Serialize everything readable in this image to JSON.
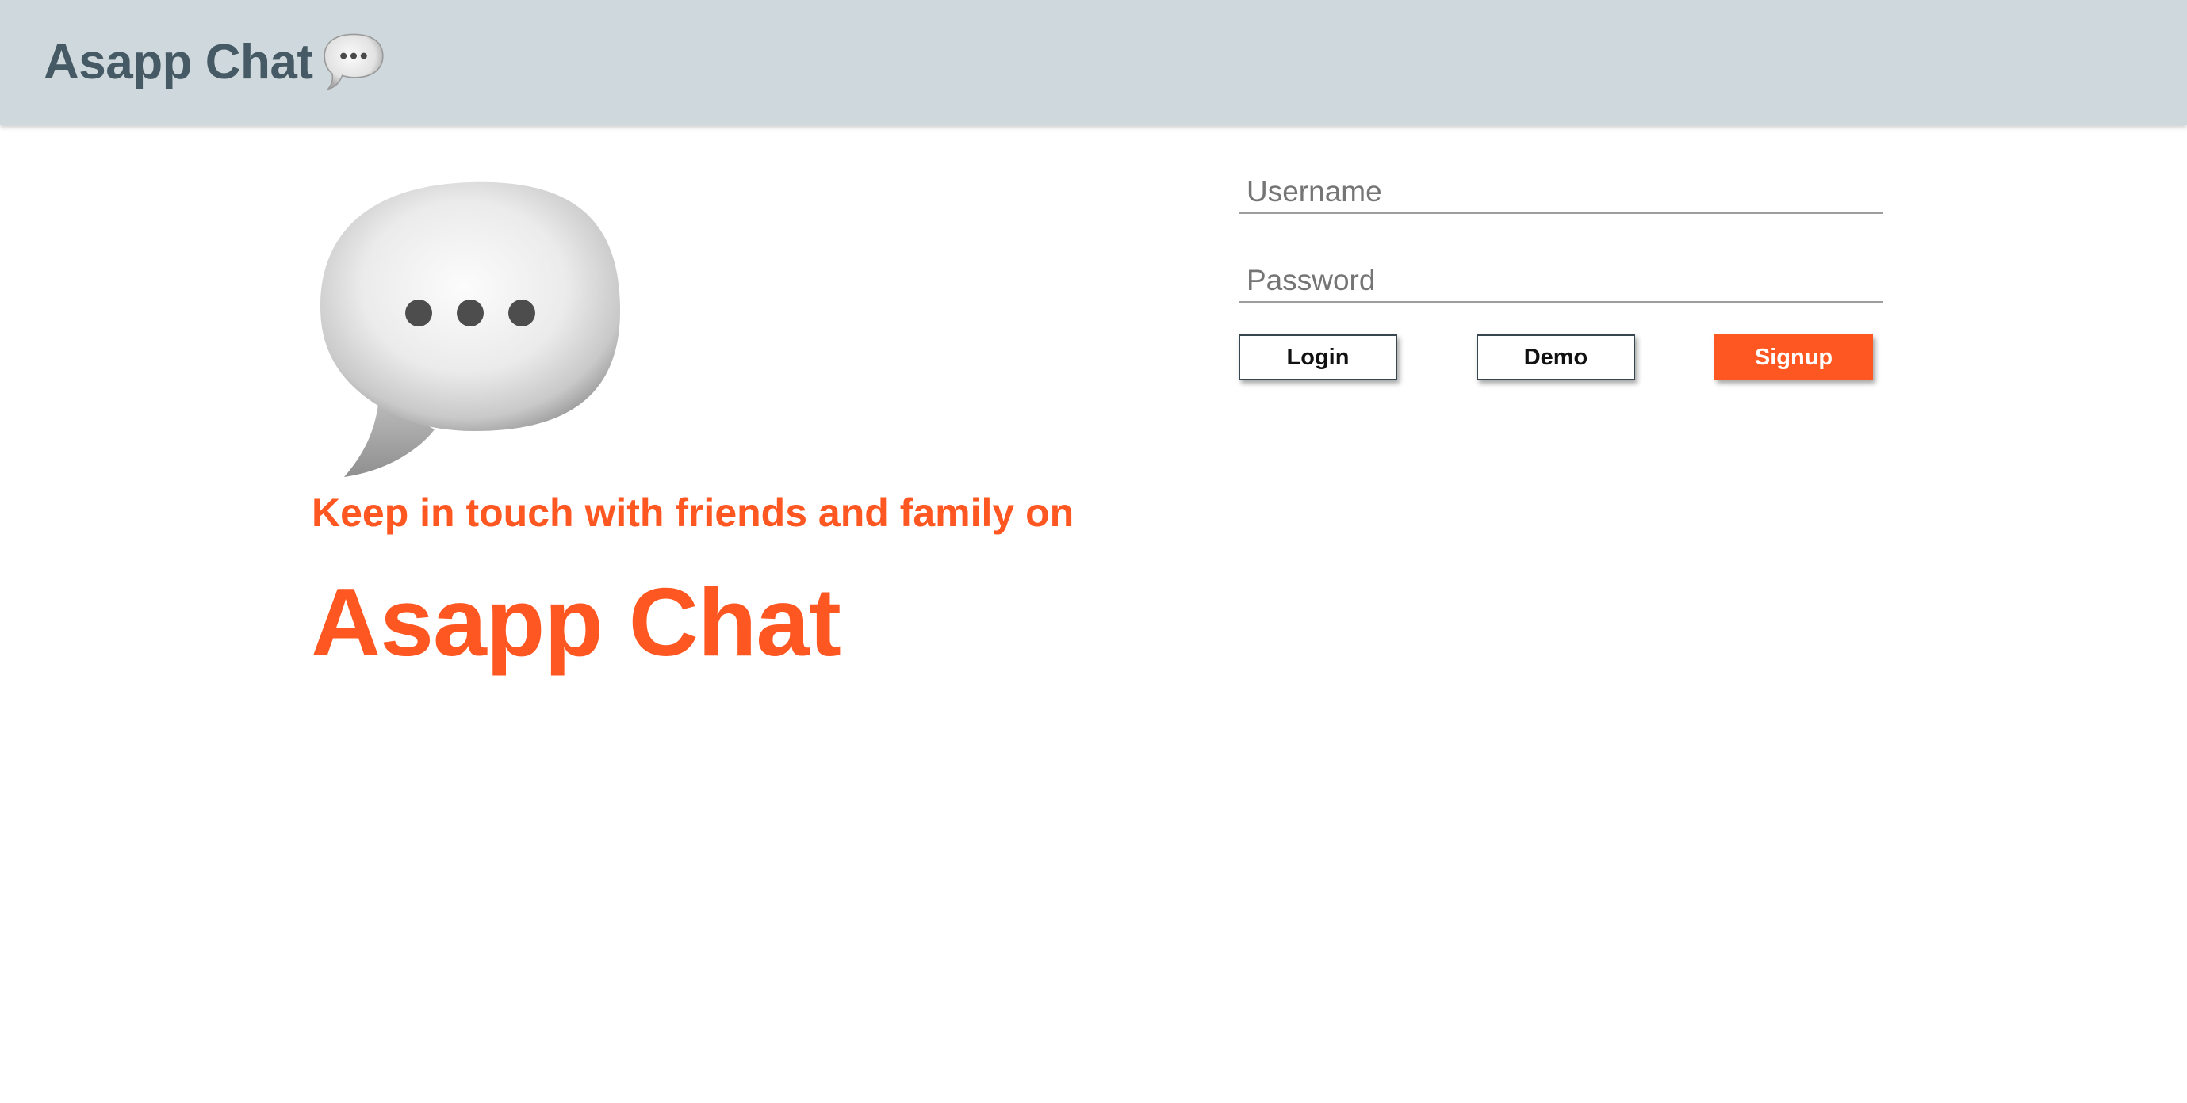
{
  "header": {
    "title": "Asapp Chat",
    "icon": "speech-balloon-icon",
    "background": "#cfd8dc",
    "title_color": "#455a64"
  },
  "hero": {
    "icon": "speech-balloon-icon",
    "tagline": "Keep in touch with friends and family on",
    "brand": "Asapp Chat",
    "accent_color": "#ff5722"
  },
  "form": {
    "username": {
      "value": "",
      "placeholder": "Username"
    },
    "password": {
      "value": "",
      "placeholder": "Password"
    },
    "buttons": {
      "login_label": "Login",
      "demo_label": "Demo",
      "signup_label": "Signup"
    }
  }
}
